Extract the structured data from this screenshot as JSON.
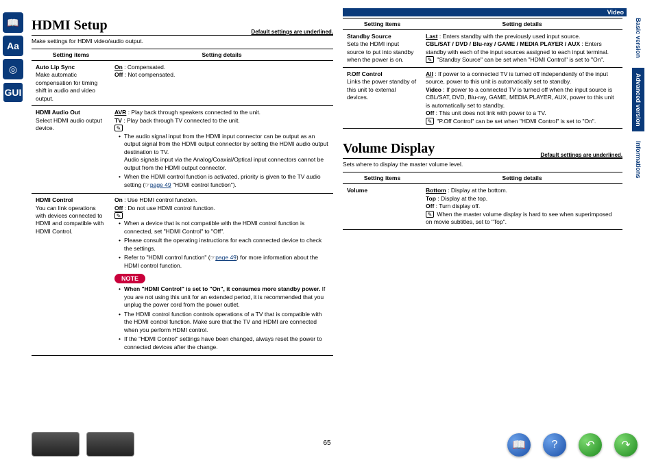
{
  "header": {
    "category": "Video"
  },
  "sideTabs": {
    "basic": "Basic version",
    "advanced": "Advanced version",
    "info": "Informations"
  },
  "pageNumber": "65",
  "defaultNote": "Default settings are underlined.",
  "tableHeaders": {
    "items": "Setting items",
    "details": "Setting details"
  },
  "hdmi": {
    "title": "HDMI Setup",
    "subtitle": "Make settings for HDMI video/audio output.",
    "rows": {
      "autoLipSync": {
        "name": "Auto Lip Sync",
        "desc": "Make automatic compensation for timing shift in audio and video output.",
        "on": "On",
        "onDesc": " : Compensated.",
        "off": "Off",
        "offDesc": " : Not compensated."
      },
      "hdmiAudioOut": {
        "name": "HDMI Audio Out",
        "desc": "Select HDMI audio output device.",
        "avr": "AVR",
        "avrDesc": " : Play back through speakers connected to the unit.",
        "tv": "TV",
        "tvDesc": " : Play back through TV connected to the unit.",
        "b1": "The audio signal input from the HDMI input connector can be output as an output signal from the HDMI output connector by setting the HDMI audio output destination to TV.",
        "b1b": "Audio signals input via the Analog/Coaxial/Optical input connectors cannot be output from the HDMI output connector.",
        "b2a": "When the HDMI control function is activated, priority is given to the TV audio setting (",
        "b2link": "page 49",
        "b2b": " \"HDMI control function\")."
      },
      "hdmiControl": {
        "name": "HDMI Control",
        "desc": "You can link operations with devices connected to HDMI and compatible with HDMI Control.",
        "on": "On",
        "onDesc": " : Use HDMI control function.",
        "off": "Off",
        "offDesc": " : Do not use HDMI control function.",
        "b1": "When a device that is not compatible with the HDMI control function is connected, set \"HDMI Control\" to \"Off\".",
        "b2": "Please consult the operating instructions for each connected device to check the settings.",
        "b3a": "Refer to \"HDMI control function\" (",
        "b3link": "page 49",
        "b3b": ") for more information about the HDMI control function.",
        "noteLabel": "NOTE",
        "n1a": "When \"HDMI Control\" is set to \"On\", it consumes more standby power.",
        "n1b": " If you are not using this unit for an extended period, it is recommended that you unplug the power cord from the power outlet.",
        "n2": "The HDMI control function controls operations of a TV that is compatible with the HDMI control function. Make sure that the TV and HDMI are connected when you perform HDMI control.",
        "n3": "If the \"HDMI Control\" settings have been changed, always reset the power to connected devices after the change."
      }
    }
  },
  "col2": {
    "standbySource": {
      "name": "Standby Source",
      "desc": "Sets the HDMI input source to put into standby when the power is on.",
      "last": "Last",
      "lastDesc": " : Enters standby with the previously used input source.",
      "list": "CBL/SAT / DVD / Blu-ray / GAME / MEDIA PLAYER / AUX",
      "listDesc": " : Enters standby with each of the input sources assigned to each input terminal.",
      "note": "\"Standby Source\" can be set when \"HDMI Control\" is set to \"On\"."
    },
    "poff": {
      "name": "P.Off Control",
      "desc": "Links the power standby of this unit to external devices.",
      "all": "All",
      "allDesc": " : If power to a connected TV is turned off independently of the input source, power to this unit is automatically set to standby.",
      "video": "Video",
      "videoDesc": " : If power to a connected TV is turned off when the input source is CBL/SAT, DVD, Blu-ray, GAME, MEDIA PLAYER, AUX, power to this unit is automatically set to standby.",
      "off": "Off",
      "offDesc": " : This unit does not link with power to a TV.",
      "note": "\"P.Off Control\" can be set when \"HDMI Control\" is set to \"On\"."
    }
  },
  "volume": {
    "title": "Volume Display",
    "subtitle": "Sets where to display the master volume level.",
    "row": {
      "name": "Volume",
      "bottom": "Bottom",
      "bottomDesc": " : Display at the bottom.",
      "top": "Top",
      "topDesc": " : Display at the top.",
      "off": "Off",
      "offDesc": " : Turn display off.",
      "note": "When the master volume display is hard to see when superimposed on movie subtitles, set to \"Top\"."
    }
  }
}
